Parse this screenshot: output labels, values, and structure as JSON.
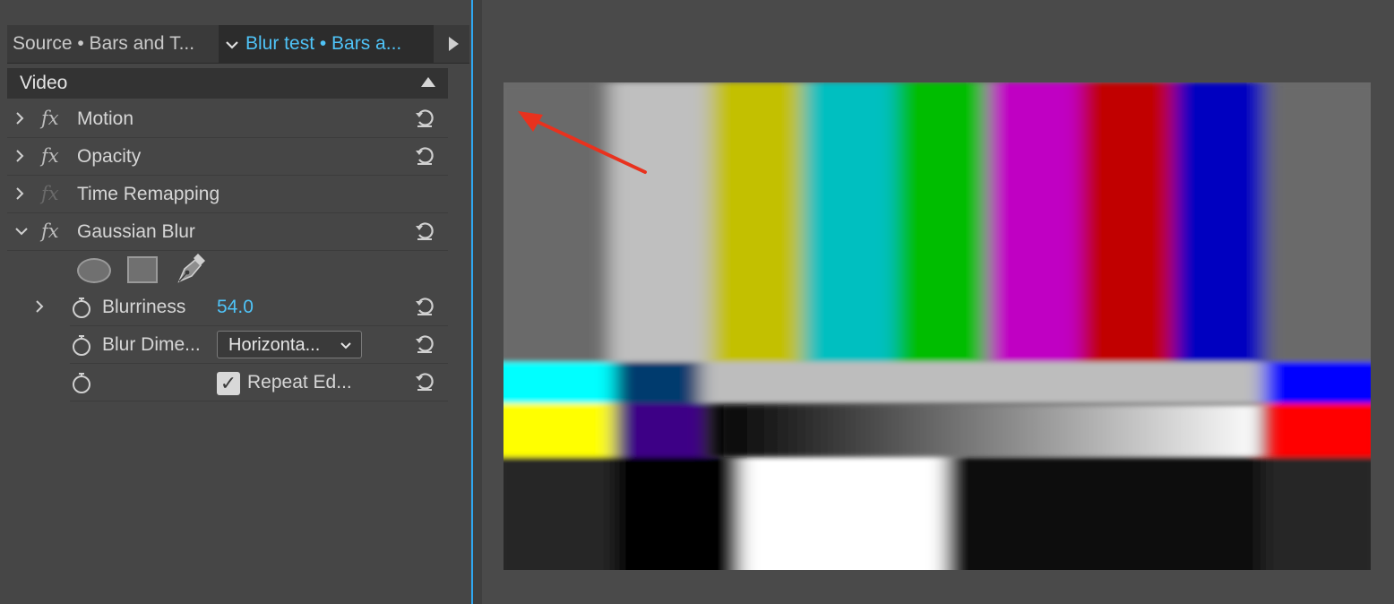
{
  "tabs": {
    "source_label": "Source • Bars and T...",
    "effects_label": "Blur test • Bars a...",
    "effects_chevron": "chevron-down-icon",
    "next_icon": "play-right-icon"
  },
  "section": {
    "title": "Video",
    "collapse_icon": "triangle-up-icon"
  },
  "effects": [
    {
      "name": "Motion",
      "expanded": false,
      "fx_enabled": true,
      "has_reset": true
    },
    {
      "name": "Opacity",
      "expanded": false,
      "fx_enabled": true,
      "has_reset": true
    },
    {
      "name": "Time Remapping",
      "expanded": false,
      "fx_enabled": false,
      "has_reset": false
    },
    {
      "name": "Gaussian Blur",
      "expanded": true,
      "fx_enabled": true,
      "has_reset": true
    }
  ],
  "fx_label": "fx",
  "gaussian_blur": {
    "mask_tools": [
      "ellipse-mask-icon",
      "rectangle-mask-icon",
      "pen-mask-icon"
    ],
    "params": {
      "blurriness": {
        "label": "Blurriness",
        "value": "54.0"
      },
      "blur_dimensions": {
        "label": "Blur Dime...",
        "value": "Horizonta..."
      },
      "repeat_edge": {
        "label": "Repeat Ed...",
        "checked": true
      }
    }
  },
  "icons": {
    "expand_collapsed": "›",
    "expand_open": "⌄",
    "dropdown_chevron": "⌄",
    "check": "✓"
  },
  "colors": {
    "accent_blue": "#4fc3f7",
    "panel_bg": "#464646",
    "annotation_arrow": "#e8321e"
  },
  "program_monitor": {
    "content": "SMPTE color bars test pattern, horizontally blurred"
  }
}
